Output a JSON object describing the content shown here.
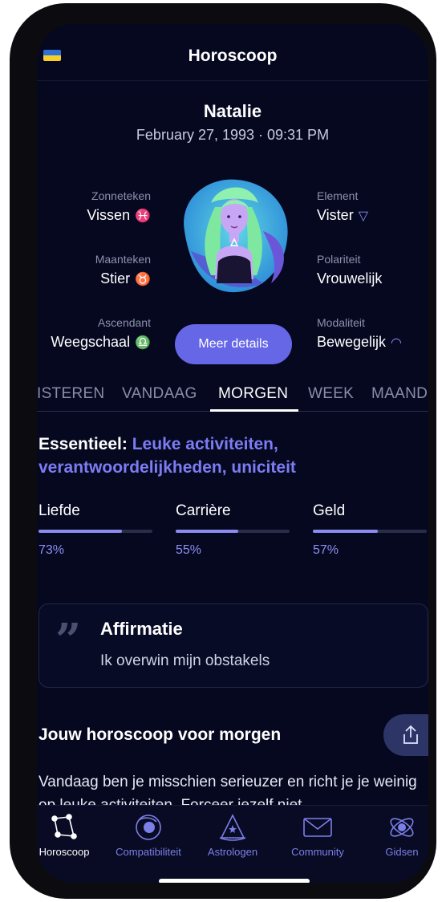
{
  "header": {
    "title": "Horoscoop"
  },
  "profile": {
    "name": "Natalie",
    "birth": "February 27, 1993 · 09:31 PM"
  },
  "attributes_left": [
    {
      "label": "Zonneteken",
      "value": "Vissen",
      "symbol": "♓"
    },
    {
      "label": "Maanteken",
      "value": "Stier",
      "symbol": "♉"
    },
    {
      "label": "Ascendant",
      "value": "Weegschaal",
      "symbol": "♎"
    }
  ],
  "attributes_right": [
    {
      "label": "Element",
      "value": "Vister",
      "symbol": "▽"
    },
    {
      "label": "Polariteit",
      "value": "Vrouwelijk"
    },
    {
      "label": "Modaliteit",
      "value": "Bewegelijk",
      "symbol": "◠"
    }
  ],
  "details_button": "Meer details",
  "tabs": [
    "ISTEREN",
    "VANDAAG",
    "MORGEN",
    "WEEK",
    "MAAND"
  ],
  "active_tab": "MORGEN",
  "essential": {
    "prefix": "Essentieel:",
    "highlight": "Leuke activiteiten, verantwoordelijkheden, uniciteit"
  },
  "meters": [
    {
      "label": "Liefde",
      "value": 0.73,
      "pct": "73%"
    },
    {
      "label": "Carrière",
      "value": 0.55,
      "pct": "55%"
    },
    {
      "label": "Geld",
      "value": 0.57,
      "pct": "57%"
    }
  ],
  "affirmation": {
    "title": "Affirmatie",
    "text": "Ik overwin mijn obstakels"
  },
  "horoscope": {
    "title": "Jouw horoscoop voor morgen",
    "text": "Vandaag ben je misschien serieuzer en richt je je weinig op leuke activiteiten. Forceer jezelf niet"
  },
  "nav": [
    {
      "label": "Horoscoop",
      "icon": "constellation-icon"
    },
    {
      "label": "Compatibiliteit",
      "icon": "orbit-icon"
    },
    {
      "label": "Astrologen",
      "icon": "wizard-hat-icon"
    },
    {
      "label": "Community",
      "icon": "envelope-icon"
    },
    {
      "label": "Gidsen",
      "icon": "atom-icon"
    }
  ],
  "colors": {
    "background": "#05081f",
    "accent": "#6667e6",
    "highlight": "#7c7cf3"
  }
}
